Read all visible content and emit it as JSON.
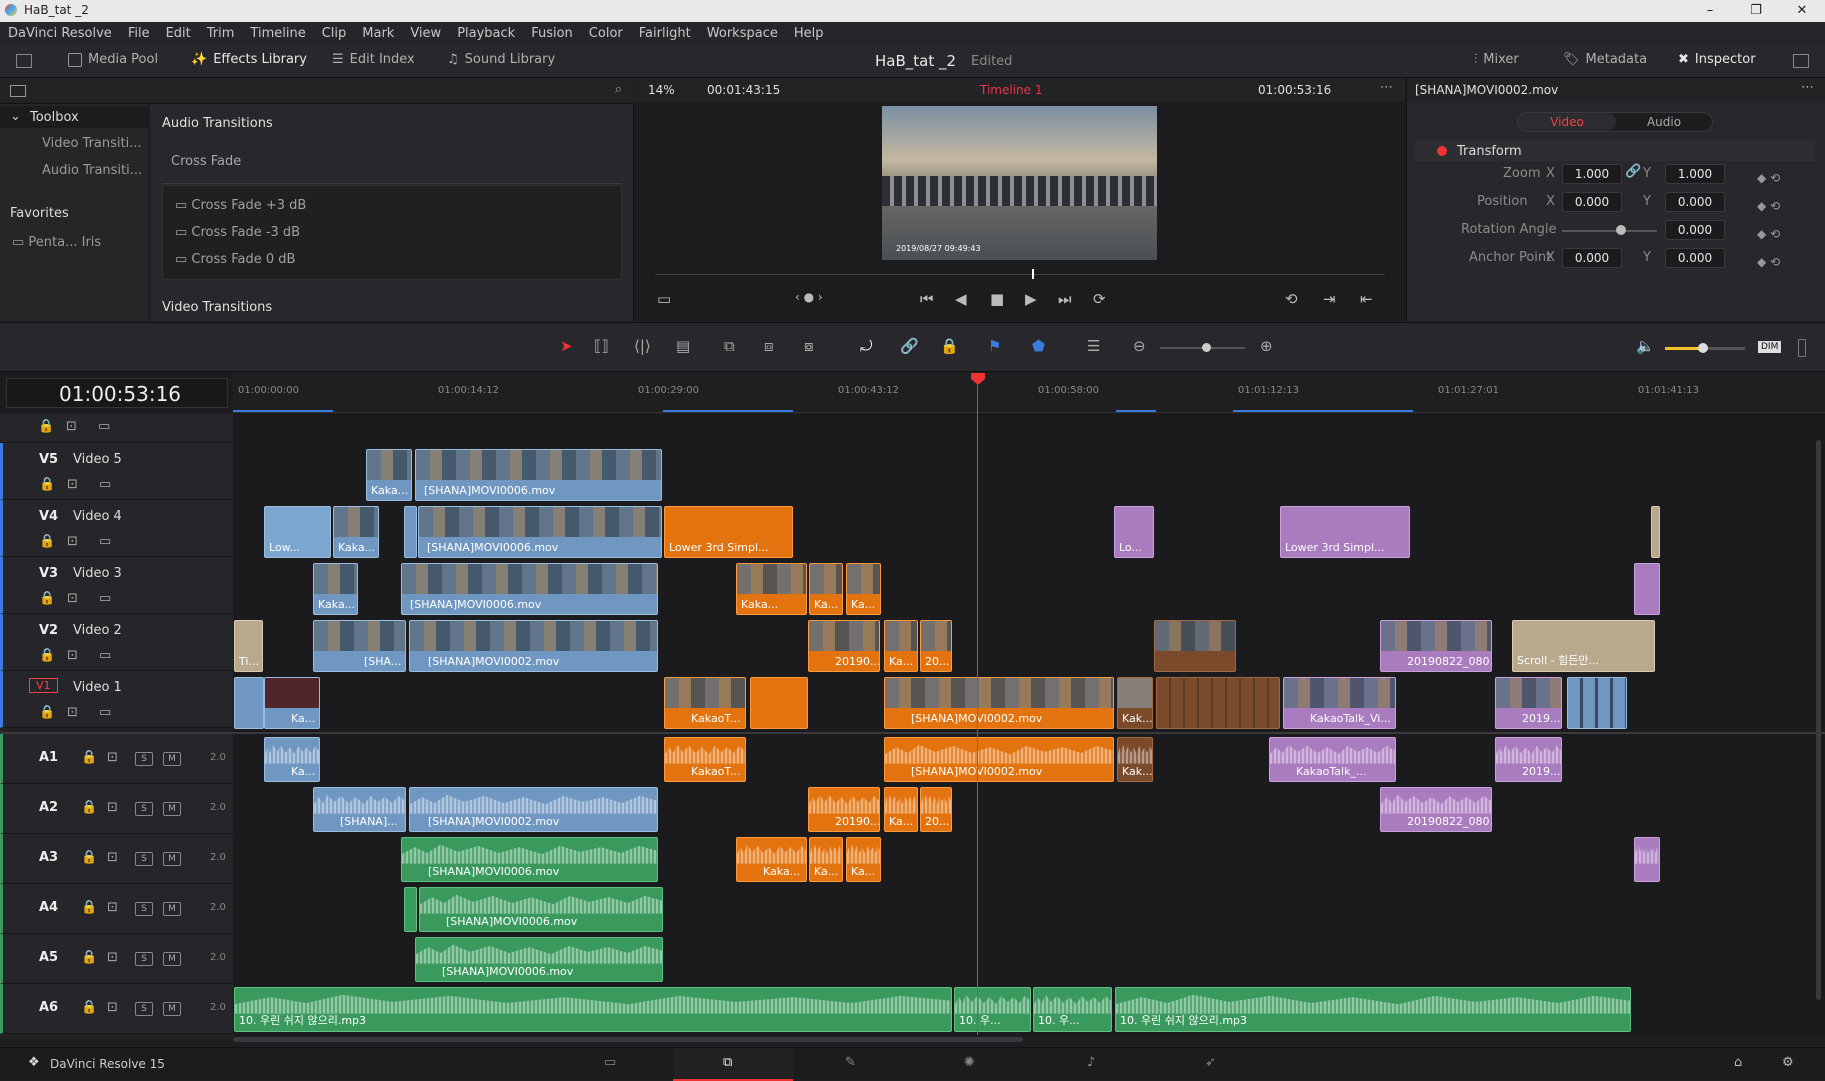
{
  "window": {
    "title": "HaB_tat _2",
    "controls": [
      "–",
      "❐",
      "✕"
    ]
  },
  "menu": [
    "DaVinci Resolve",
    "File",
    "Edit",
    "Trim",
    "Timeline",
    "Clip",
    "Mark",
    "View",
    "Playback",
    "Fusion",
    "Color",
    "Fairlight",
    "Workspace",
    "Help"
  ],
  "toolbar": {
    "media_pool": "Media Pool",
    "effects_library": "Effects Library",
    "edit_index": "Edit Index",
    "sound_library": "Sound Library",
    "project": "HaB_tat _2",
    "status": "Edited",
    "mixer": "Mixer",
    "metadata": "Metadata",
    "inspector": "Inspector"
  },
  "effects": {
    "toolbox": "Toolbox",
    "items": [
      "Video Transiti...",
      "Audio Transiti..."
    ],
    "favorites": "Favorites",
    "fav_item": "Penta... Iris",
    "section": "Audio Transitions",
    "group": "Cross Fade",
    "crossfades": [
      "Cross Fade +3 dB",
      "Cross Fade -3 dB",
      "Cross Fade 0 dB"
    ],
    "section2": "Video Transitions"
  },
  "viewer": {
    "zoom": "14%",
    "duration": "00:01:43:15",
    "timeline_name": "Timeline 1",
    "timecode": "01:00:53:16",
    "overlay_text": "2019/08/27 09:49:43"
  },
  "inspector": {
    "clip": "[SHANA]MOVI0002.mov",
    "tab_video": "Video",
    "tab_audio": "Audio",
    "section": "Transform",
    "zoom_label": "Zoom",
    "zoom_x": "1.000",
    "zoom_y": "1.000",
    "position_label": "Position",
    "pos_x": "0.000",
    "pos_y": "0.000",
    "rotation_label": "Rotation Angle",
    "rotation": "0.000",
    "anchor_label": "Anchor Point",
    "anchor_x": "0.000",
    "anchor_y": "0.000",
    "x": "X",
    "y": "Y"
  },
  "timeline": {
    "timecode": "01:00:53:16",
    "ruler": [
      "01:00:00:00",
      "01:00:14:12",
      "01:00:29:00",
      "01:00:43:12",
      "01:00:58:00",
      "01:01:12:13",
      "01:01:27:01",
      "01:01:41:13"
    ],
    "dim": "DIM"
  },
  "video_tracks": [
    {
      "id": "V5",
      "name": "Video 5"
    },
    {
      "id": "V4",
      "name": "Video 4"
    },
    {
      "id": "V3",
      "name": "Video 3"
    },
    {
      "id": "V2",
      "name": "Video 2"
    },
    {
      "id": "V1",
      "name": "Video 1"
    }
  ],
  "audio_tracks": [
    {
      "id": "A1",
      "level": "2.0"
    },
    {
      "id": "A2",
      "level": "2.0"
    },
    {
      "id": "A3",
      "level": "2.0"
    },
    {
      "id": "A4",
      "level": "2.0"
    },
    {
      "id": "A5",
      "level": "2.0"
    },
    {
      "id": "A6",
      "level": "2.0"
    }
  ],
  "clips": {
    "v5": [
      "Kaka...",
      "[SHANA]MOVI0006.mov"
    ],
    "v4": [
      "Low...",
      "Kaka...",
      "[SHANA]MOVI0006.mov",
      "Lower 3rd Simpl...",
      "Lo...",
      "Lower 3rd Simpl..."
    ],
    "v3": [
      "Kaka...",
      "[SHANA]MOVI0006.mov",
      "Kaka...",
      "Ka...",
      "Ka..."
    ],
    "v2": [
      "Ti...",
      "[SHA...",
      "[SHANA]MOVI0002.mov",
      "20190...",
      "Ka...",
      "20...",
      "20190822_080...",
      "Scroll - 힘든만..."
    ],
    "v1": [
      "Ka...",
      "KakaoT...",
      "[SHANA]MOVI0002.mov",
      "Kak...",
      "KakaoTalk_Vi...",
      "2019..."
    ],
    "a1": [
      "Ka...",
      "KakaoT...",
      "[SHANA]MOVI0002.mov",
      "Kak...",
      "KakaoTalk_...",
      "2019..."
    ],
    "a2": [
      "[SHANA]...",
      "[SHANA]MOVI0002.mov",
      "20190...",
      "Ka...",
      "20...",
      "20190822_080..."
    ],
    "a3": [
      "[SHANA]MOVI0006.mov",
      "Kaka...",
      "Ka...",
      "Ka..."
    ],
    "a4": [
      "[SHANA]MOVI0006.mov"
    ],
    "a5": [
      "[SHANA]MOVI0006.mov"
    ],
    "a6": [
      "10. 우린 쉬지 않으리.mp3",
      "10. 우...",
      "10. 우...",
      "10. 우린 쉬지 않으리.mp3"
    ]
  },
  "footer": {
    "app": "DaVinci Resolve 15"
  }
}
